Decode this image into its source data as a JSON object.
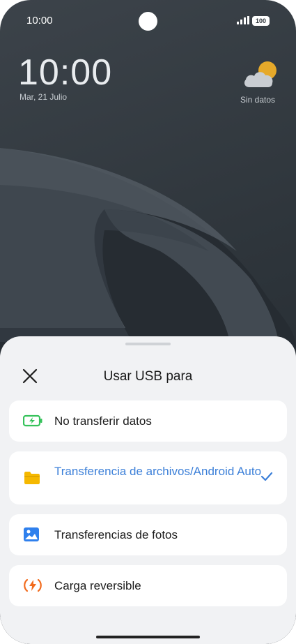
{
  "status_bar": {
    "time": "10:00",
    "battery": "100"
  },
  "lockscreen": {
    "time": "10:00",
    "date": "Mar, 21 Julio",
    "weather_label": "Sin datos",
    "weather_icon": "partly-cloudy-icon"
  },
  "usb_sheet": {
    "title": "Usar USB para",
    "close_icon": "close-icon",
    "options": [
      {
        "label": "No transferir datos",
        "icon": "battery-charging-icon",
        "selected": false
      },
      {
        "label": "Transferencia de archivos/Android Auto",
        "icon": "folder-icon",
        "selected": true
      },
      {
        "label": "Transferencias de fotos",
        "icon": "image-icon",
        "selected": false
      },
      {
        "label": "Carga reversible",
        "icon": "reverse-charge-icon",
        "selected": false
      }
    ]
  },
  "colors": {
    "accent": "#3b7fd8",
    "sheet_bg": "#f1f2f4",
    "battery_icon": "#36c25b",
    "folder_icon": "#f5b800",
    "image_icon": "#2f80ed",
    "reverse_charge_icon": "#f26b1d"
  }
}
